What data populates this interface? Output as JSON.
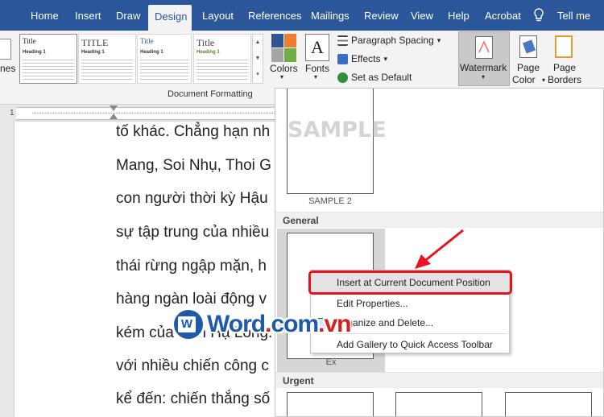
{
  "tabs": [
    {
      "label": "Home"
    },
    {
      "label": "Insert"
    },
    {
      "label": "Draw"
    },
    {
      "label": "Design"
    },
    {
      "label": "Layout"
    },
    {
      "label": "References"
    },
    {
      "label": "Mailings"
    },
    {
      "label": "Review"
    },
    {
      "label": "View"
    },
    {
      "label": "Help"
    },
    {
      "label": "Acrobat"
    },
    {
      "label": "Tell me"
    }
  ],
  "ribbon": {
    "partial_left_label": "nes",
    "style_gallery": [
      {
        "title": "Title",
        "heading": "Heading 1"
      },
      {
        "title": "TITLE",
        "heading": "Heading 1"
      },
      {
        "title": "Title",
        "heading": "Heading 1"
      },
      {
        "title": "Title",
        "heading": "Heading 1"
      }
    ],
    "group_document_formatting": "Document Formatting",
    "colors_label": "Colors",
    "fonts_label": "Fonts",
    "fonts_glyph": "A",
    "paragraph_spacing": "Paragraph Spacing",
    "effects": "Effects",
    "set_as_default": "Set as Default",
    "watermark": "Watermark",
    "page_color_1": "Page",
    "page_color_2": "Color",
    "page_borders_1": "Page",
    "page_borders_2": "Borders",
    "accent": "#2b579a"
  },
  "ruler": {
    "start": "1"
  },
  "document": {
    "lines": [
      "tố khác. Chẳng hạn nh",
      "Mang, Soi Nhụ, Thoi G",
      "con người thời kỳ Hậu",
      "sự tập trung của nhiều",
      "thái rừng ngập mặn, h",
      "hàng ngàn loài động v",
      "kém của vịnh Hạ Long.",
      "với nhiều chiến công c",
      "kể đến: chiến thắng số"
    ]
  },
  "gallery": {
    "sample_text": "SAMPLE",
    "sample_caption": "SAMPLE 2",
    "section_general": "General",
    "section_urgent": "Urgent",
    "general_caption": "Ex"
  },
  "context_menu": {
    "items": [
      "Insert at Current Document Position",
      "Edit Properties...",
      "Organize and Delete...",
      "Add Gallery to Quick Access Toolbar"
    ]
  },
  "logo": {
    "w": "W",
    "word": "Word",
    "dot": ".",
    "com": "com",
    "dot2": ".",
    "vn": "vn"
  }
}
